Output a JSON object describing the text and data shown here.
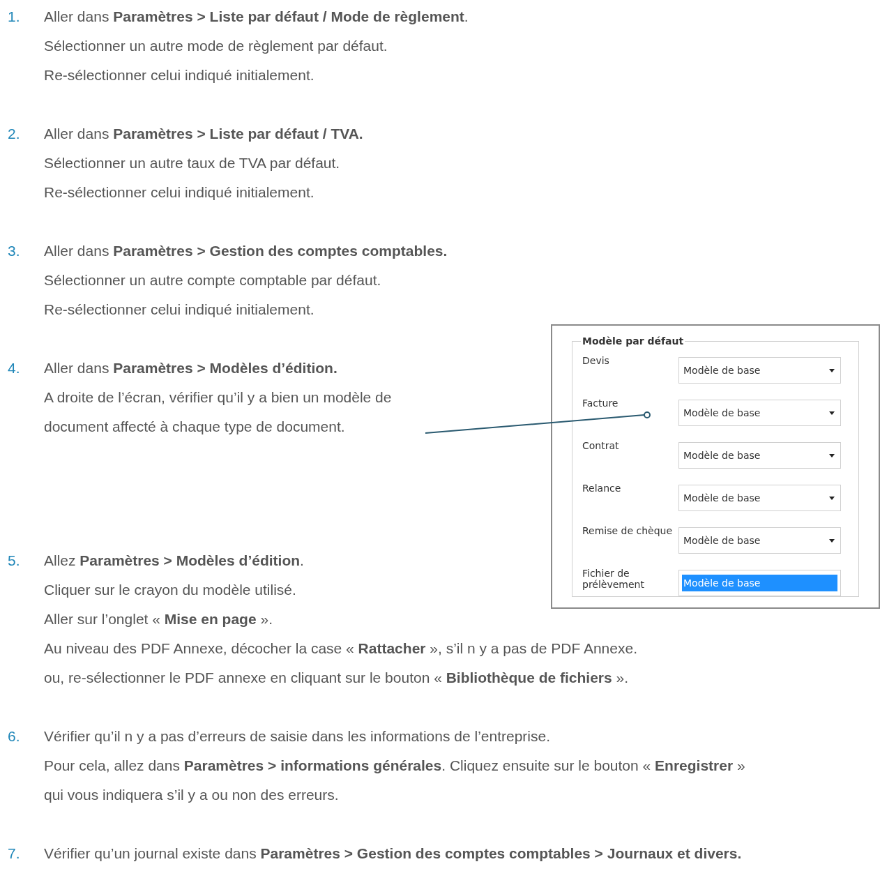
{
  "steps": [
    {
      "number": "1.",
      "lines": [
        "Aller dans **Paramètres >  Liste par défaut / Mode de règlement**.",
        "Sélectionner un autre mode de règlement par défaut.",
        "Re-sélectionner celui indiqué initialement."
      ]
    },
    {
      "number": "2.",
      "lines": [
        "Aller dans **Paramètres >  Liste par défaut / TVA.**",
        "Sélectionner un autre taux de TVA par défaut.",
        "Re-sélectionner celui indiqué initialement."
      ]
    },
    {
      "number": "3.",
      "lines": [
        "Aller dans **Paramètres > Gestion des comptes comptables.**",
        "Sélectionner un autre compte comptable  par défaut.",
        "Re-sélectionner celui indiqué initialement."
      ]
    },
    {
      "number": "4.",
      "lines": [
        "Aller dans **Paramètres > Modèles d’édition.**",
        "A droite de l’écran, vérifier qu’il y a bien un modèle de",
        "document affecté à chaque type de document."
      ],
      "figure": {
        "legend": "Modèle par défaut",
        "rows": [
          {
            "label": "Devis",
            "value": "Modèle de base",
            "selected": false
          },
          {
            "label": "Facture",
            "value": "Modèle de base",
            "selected": false
          },
          {
            "label": "Contrat",
            "value": "Modèle de base",
            "selected": false
          },
          {
            "label": "Relance",
            "value": "Modèle de base",
            "selected": false
          },
          {
            "label": "Remise de chèque",
            "value": "Modèle de base",
            "selected": false
          },
          {
            "label": "Fichier de prélèvement",
            "value": "Modèle de base",
            "selected": true
          }
        ]
      }
    },
    {
      "number": "5.",
      "lines": [
        "Allez **Paramètres > Modèles d’édition**.",
        "Cliquer sur le crayon du modèle utilisé.",
        "Aller sur l’onglet «  **Mise en page** ».",
        "Au niveau des PDF Annexe, décocher la case «  **Rattacher** », s’il n y a pas de PDF Annexe.",
        "ou, re-sélectionner le PDF annexe en cliquant sur le bouton «  **Bibliothèque de fichiers** »."
      ]
    },
    {
      "number": "6.",
      "lines": [
        "Vérifier qu’il n y a pas d’erreurs de saisie dans les informations de l’entreprise.",
        "Pour cela, allez dans **Paramètres > informations générales**. Cliquez ensuite sur le bouton « **Enregistrer** »",
        "qui vous indiquera s’il y a ou non des erreurs."
      ]
    },
    {
      "number": "7.",
      "lines": [
        "Vérifier qu’un journal existe dans **Paramètres > Gestion des comptes comptables > Journaux et divers.**"
      ]
    }
  ]
}
